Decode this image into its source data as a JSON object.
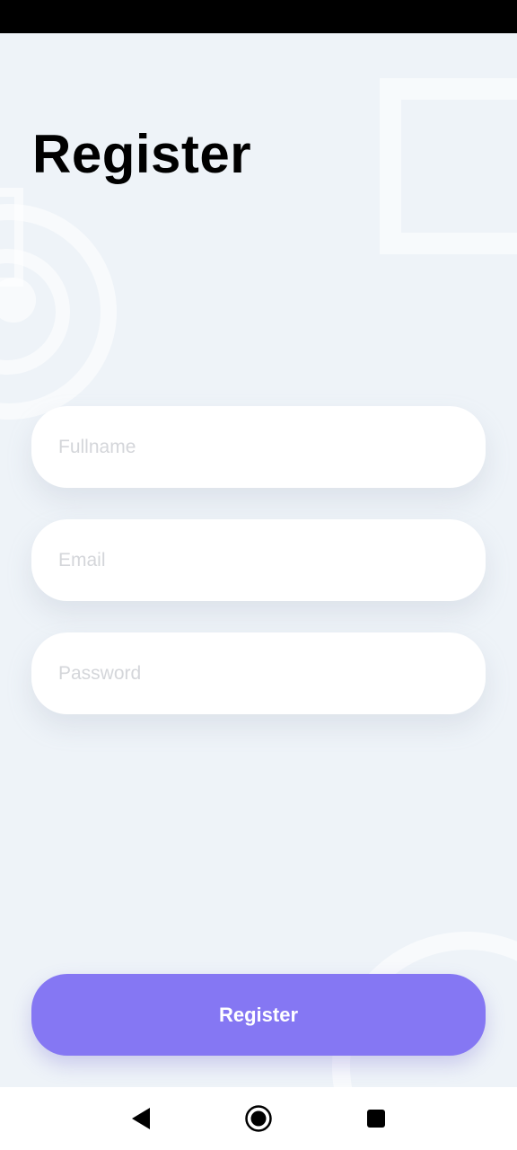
{
  "title": "Register",
  "form": {
    "fullname_placeholder": "Fullname",
    "email_placeholder": "Email",
    "password_placeholder": "Password",
    "fullname_value": "",
    "email_value": "",
    "password_value": ""
  },
  "submit": {
    "label": "Register"
  },
  "colors": {
    "background": "#eef3f8",
    "accent": "#8577f3",
    "field": "#ffffff",
    "placeholder": "#d4d6da"
  },
  "nav": {
    "back_icon": "back-triangle-icon",
    "home_icon": "home-circle-icon",
    "recent_icon": "recents-square-icon"
  }
}
